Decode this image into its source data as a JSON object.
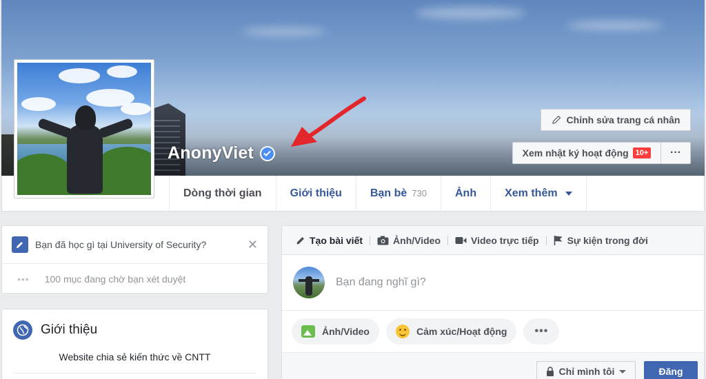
{
  "profile": {
    "name": "AnonyViet",
    "verified": true,
    "edit_profile_label": "Chỉnh sửa trang cá nhân",
    "activity_log_label": "Xem nhật ký hoạt động",
    "activity_badge": "10+",
    "more_label": "···"
  },
  "tabs": [
    {
      "label": "Dòng thời gian",
      "active": true
    },
    {
      "label": "Giới thiệu"
    },
    {
      "label": "Bạn bè",
      "count": "730"
    },
    {
      "label": "Ảnh"
    },
    {
      "label": "Xem thêm"
    }
  ],
  "prompt_card": {
    "question": "Bạn đã học gì tại University of Security?",
    "close": "✕",
    "pending_dots": "•••",
    "pending_text": "100 mục đang chờ bạn xét duyệt"
  },
  "intro_card": {
    "title": "Giới thiệu",
    "description": "Website chia sẻ kiến thức về CNTT"
  },
  "composer": {
    "tabs": [
      "Tạo bài viết",
      "Ảnh/Video",
      "Video trực tiếp",
      "Sự kiện trong đời"
    ],
    "placeholder": "Bạn đang nghĩ gì?",
    "actions": [
      "Ảnh/Video",
      "Cảm xúc/Hoạt động"
    ],
    "more": "•••",
    "privacy_label": "Chỉ mình tôi",
    "post_label": "Đăng"
  },
  "colors": {
    "brand_blue": "#4267b2",
    "link_blue": "#365899",
    "badge_red": "#fa3e3e",
    "page_bg": "#e9ebee"
  }
}
